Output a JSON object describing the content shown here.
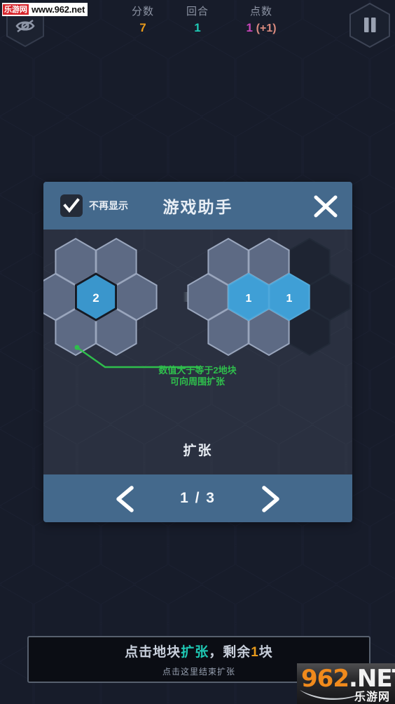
{
  "hud": {
    "stats": [
      {
        "label": "分数",
        "value": "7",
        "color": "#e89a1b"
      },
      {
        "label": "回合",
        "value": "1",
        "color": "#1fc8b4"
      },
      {
        "label": "点数",
        "value": "1",
        "extra": "(+1)",
        "color": "#c845b8",
        "extra_color": "#d98a7e"
      }
    ],
    "hide_icon": "eye-off-icon",
    "pause_icon": "pause-icon"
  },
  "watermark_top": {
    "logo": "乐游网",
    "url": "www.962.net"
  },
  "watermark_bottom": {
    "num": "962",
    "net": ".NET",
    "cn": "乐游网"
  },
  "dialog": {
    "checkbox": {
      "label": "不再显示",
      "checked": true
    },
    "title": "游戏助手",
    "close_icon": "close-icon",
    "caption": "扩张",
    "annotation": {
      "line1": "数值大于等于2地块",
      "line2": "可向周围扩张",
      "color": "#2fbf4c"
    },
    "left_cluster": {
      "center_value": "2"
    },
    "right_cluster": {
      "values": [
        "1",
        "1"
      ]
    },
    "arrow_icon": "arrow-right-icon",
    "footer": {
      "prev_icon": "chevron-left-icon",
      "next_icon": "chevron-right-icon",
      "page_text": "1 / 3"
    }
  },
  "status": {
    "main_a": "点击地块",
    "main_hl": "扩张",
    "main_b": "，剩余",
    "main_count": "1",
    "main_c": "块",
    "sub": "点击这里结束扩张"
  },
  "colors": {
    "bg": "#151924",
    "dialog_header": "#44698c",
    "dialog_body": "#262c39",
    "hex_tile": "#5d6a84",
    "hex_active": "#3a96cc"
  }
}
